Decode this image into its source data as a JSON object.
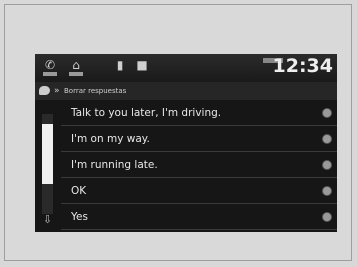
{
  "statusbar": {
    "icons": [
      "phone-icon",
      "home-icon",
      "media-icon",
      "info-icon"
    ],
    "time": "12:34"
  },
  "header": {
    "icon": "message-bubble-icon",
    "arrow": "»",
    "label": "Borrar respuestas"
  },
  "list": {
    "items": [
      {
        "label": "Talk to you later, I'm driving."
      },
      {
        "label": "I'm on my way."
      },
      {
        "label": "I'm running late."
      },
      {
        "label": "OK"
      },
      {
        "label": "Yes"
      }
    ]
  },
  "colors": {
    "screen_bg": "#161616",
    "text": "#e8e8e8",
    "scroll_thumb": "#f1f1f1"
  }
}
